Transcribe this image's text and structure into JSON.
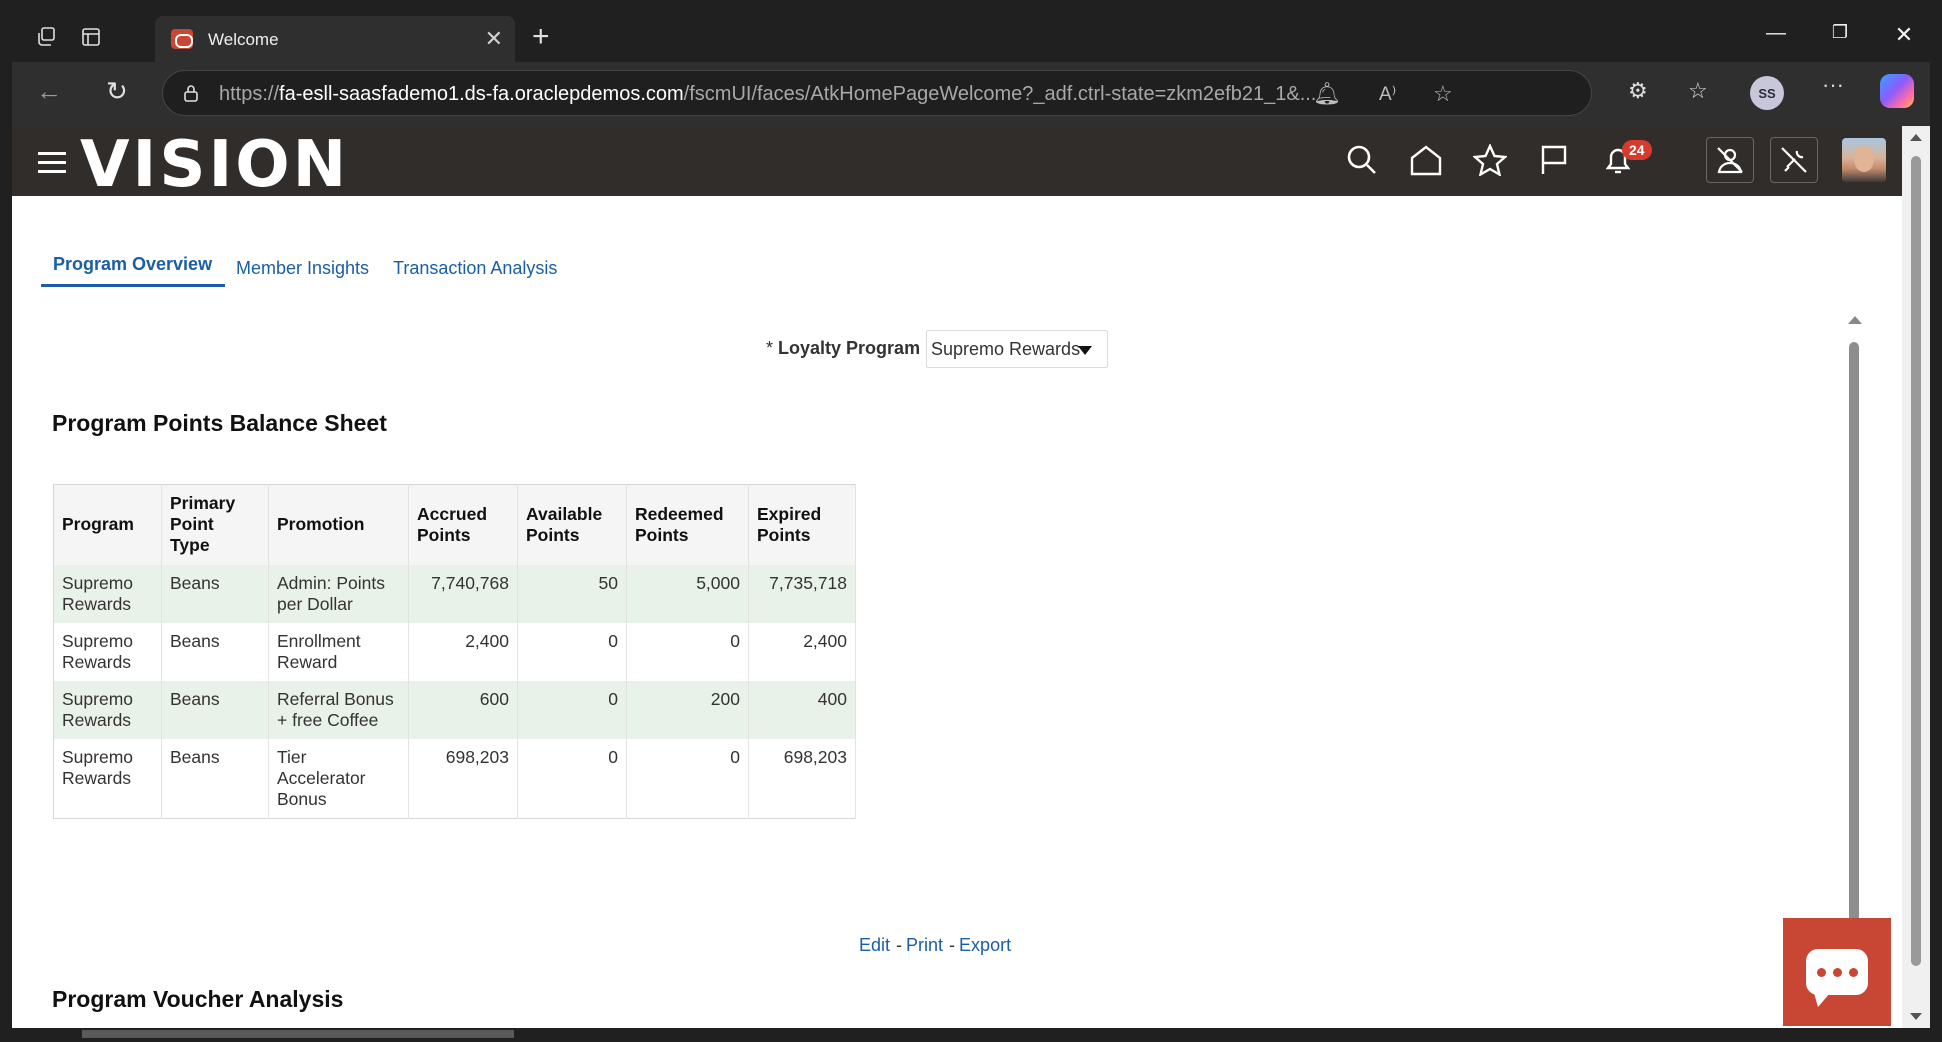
{
  "browser": {
    "tab_title": "Welcome",
    "url_prefix": "https://",
    "url_host": "fa-esll-saasfademo1.ds-fa.oraclepdemos.com",
    "url_path": "/fscmUI/faces/AtkHomePageWelcome?_adf.ctrl-state=zkm2efb21_1&...",
    "profile_initials": "SS"
  },
  "header": {
    "logo": "VISION",
    "notification_count": "24"
  },
  "tabs": [
    {
      "label": "Program Overview",
      "active": true
    },
    {
      "label": "Member Insights",
      "active": false
    },
    {
      "label": "Transaction Analysis",
      "active": false
    }
  ],
  "filter": {
    "required_mark": "*",
    "label": "Loyalty Program",
    "value": "Supremo Rewards"
  },
  "balance_sheet": {
    "title": "Program Points Balance Sheet",
    "headers": {
      "program": "Program",
      "primary_point_type_1": "Primary",
      "primary_point_type_2": "Point",
      "primary_point_type_3": "Type",
      "promotion": "Promotion",
      "accrued_1": "Accrued",
      "accrued_2": "Points",
      "available_1": "Available",
      "available_2": "Points",
      "redeemed_1": "Redeemed",
      "redeemed_2": "Points",
      "expired_1": "Expired",
      "expired_2": "Points"
    },
    "rows": [
      {
        "program_1": "Supremo",
        "program_2": "Rewards",
        "type": "Beans",
        "promo_1": "Admin: Points",
        "promo_2": "per Dollar",
        "promo_3": "",
        "accrued": "7,740,768",
        "available": "50",
        "redeemed": "5,000",
        "expired": "7,735,718"
      },
      {
        "program_1": "Supremo",
        "program_2": "Rewards",
        "type": "Beans",
        "promo_1": "Enrollment",
        "promo_2": "Reward",
        "promo_3": "",
        "accrued": "2,400",
        "available": "0",
        "redeemed": "0",
        "expired": "2,400"
      },
      {
        "program_1": "Supremo",
        "program_2": "Rewards",
        "type": "Beans",
        "promo_1": "Referral Bonus",
        "promo_2": "+ free Coffee",
        "promo_3": "",
        "accrued": "600",
        "available": "0",
        "redeemed": "200",
        "expired": "400"
      },
      {
        "program_1": "Supremo",
        "program_2": "Rewards",
        "type": "Beans",
        "promo_1": "Tier",
        "promo_2": "Accelerator",
        "promo_3": "Bonus",
        "accrued": "698,203",
        "available": "0",
        "redeemed": "0",
        "expired": "698,203"
      }
    ]
  },
  "actions": {
    "edit": "Edit",
    "print": "Print",
    "export": "Export",
    "separator": "-"
  },
  "voucher": {
    "title": "Program Voucher Analysis"
  },
  "colors": {
    "oracle_red": "#c74634",
    "header_bg": "#312d2a",
    "link_blue": "#1a5ea8",
    "row_shade": "#e9f2e9"
  }
}
